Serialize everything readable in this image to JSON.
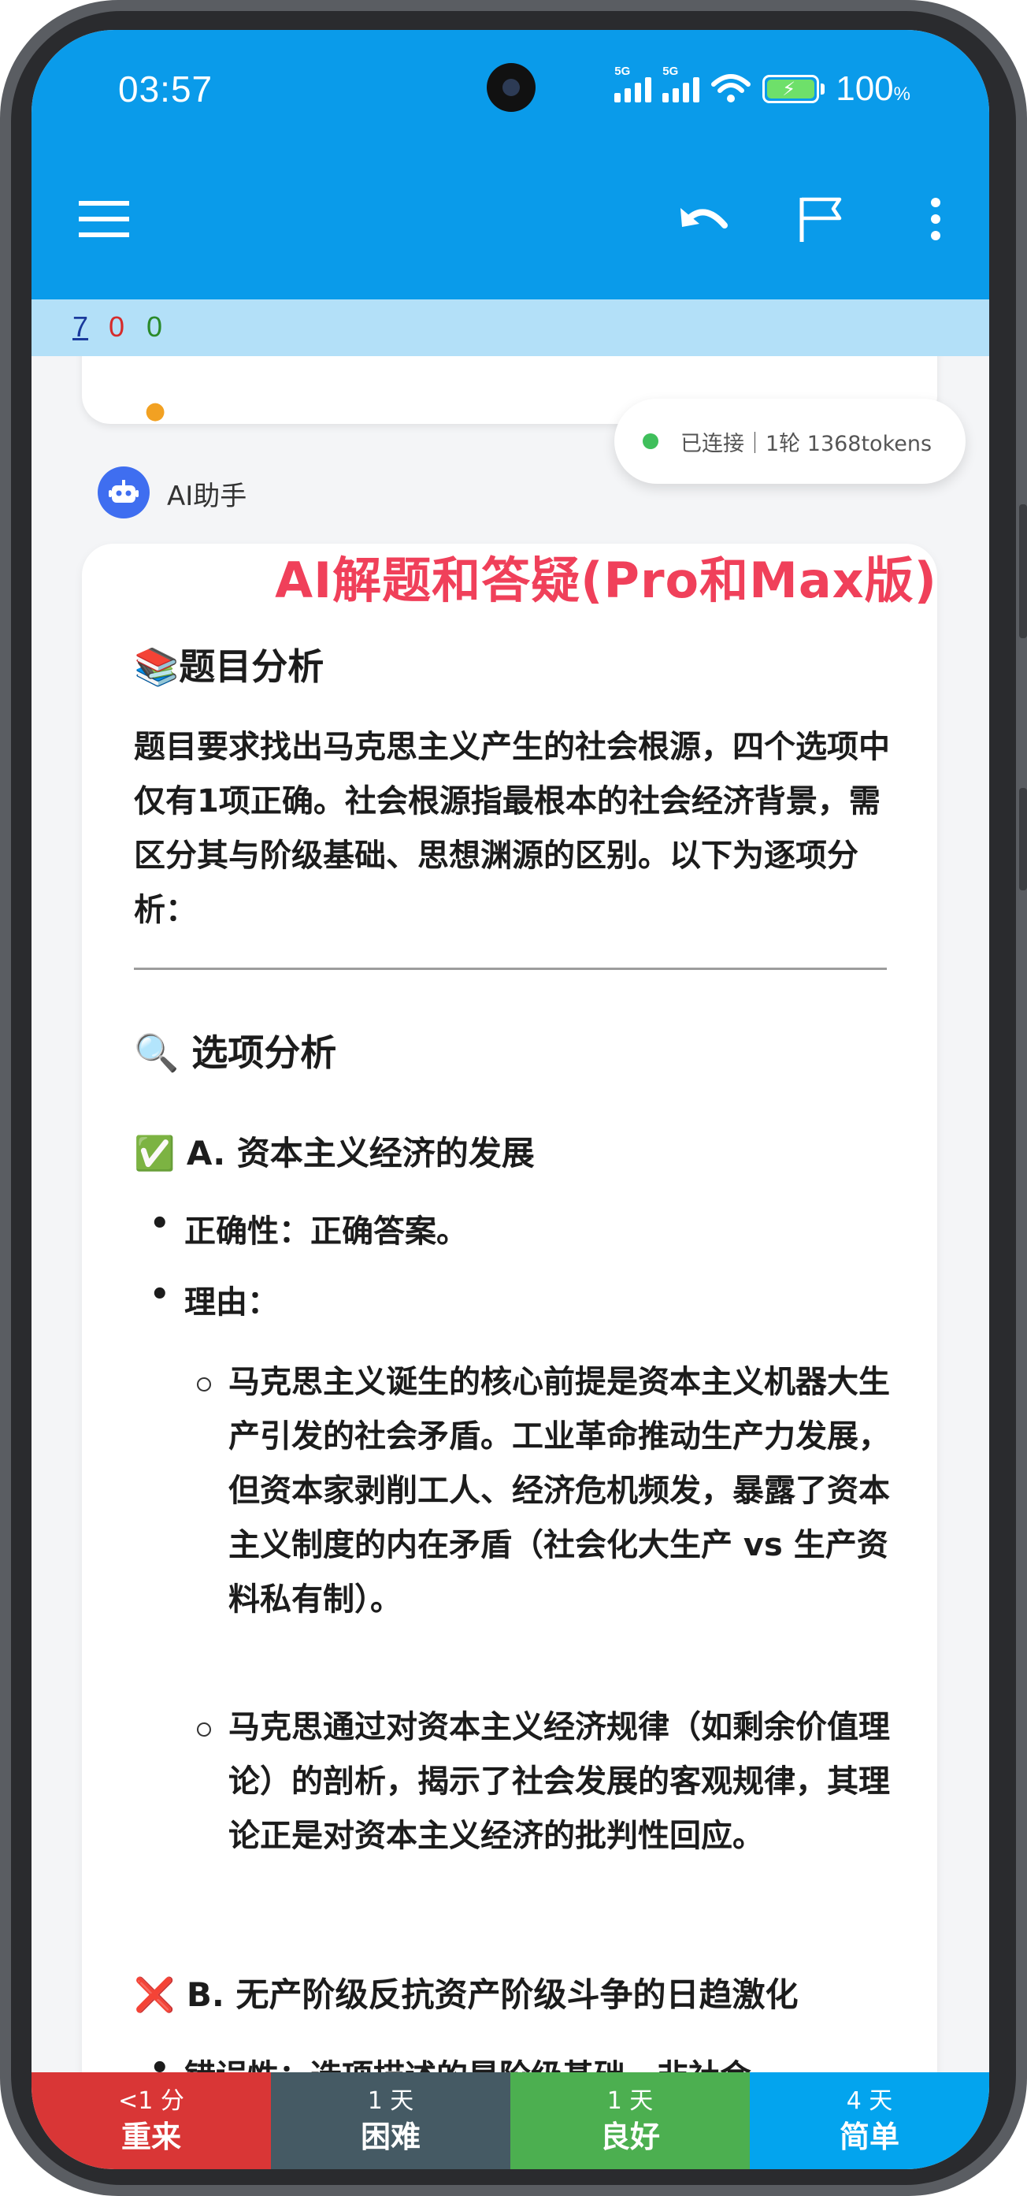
{
  "status_bar": {
    "time": "03:57",
    "network_label_1": "5G",
    "network_label_2": "5G",
    "battery_percent": "100",
    "battery_unit": "%"
  },
  "toolbar": {
    "icons": [
      "menu-icon",
      "undo-icon",
      "flag-icon",
      "more-vertical-icon"
    ],
    "background": "#0a9bea"
  },
  "counts": {
    "new": "7",
    "learning": "0",
    "review": "0",
    "colors": {
      "new": "#1a3a9c",
      "learning": "#d62b2b",
      "review": "#2a8a2a"
    }
  },
  "connection": {
    "status_text": "已连接｜1轮 1368tokens"
  },
  "assistant": {
    "name": "AI助手"
  },
  "promo_overlay": "AI解题和答疑(Pro和Max版)",
  "answer": {
    "heading_analysis": "📚题目分析",
    "analysis_paragraph": "题目要求找出马克思主义产生的社会根源，四个选项中仅有1项正确。社会根源指最根本的社会经济背景，需区分其与阶级基础、思想渊源的区别。以下为逐项分析：",
    "heading_options": "🔍 选项分析",
    "option_a_title": "✅ A. 资本主义经济的发展",
    "option_a_correctness": "正确性：正确答案。",
    "option_a_reason_label": "理由：",
    "option_a_reasons": [
      "马克思主义诞生的核心前提是资本主义机器大生产引发的社会矛盾。工业革命推动生产力发展，但资本家剥削工人、经济危机频发，暴露了资本主义制度的内在矛盾（社会化大生产 vs 生产资料私有制）。",
      "马克思通过对资本主义经济规律（如剩余价值理论）的剖析，揭示了社会发展的客观规律，其理论正是对资本主义经济的批判性回应。"
    ],
    "option_b_title": "❌ B. 无产阶级反抗资产阶级斗争的日趋激化",
    "option_b_partial": "错误性：选项描述的是阶级基础，非社会"
  },
  "grade_buttons": [
    {
      "interval": "<1 分",
      "label": "重来",
      "color": "#d93636"
    },
    {
      "interval": "1 天",
      "label": "困难",
      "color": "#455a64"
    },
    {
      "interval": "1 天",
      "label": "良好",
      "color": "#4caf50"
    },
    {
      "interval": "4 天",
      "label": "简单",
      "color": "#03a4ee"
    }
  ]
}
